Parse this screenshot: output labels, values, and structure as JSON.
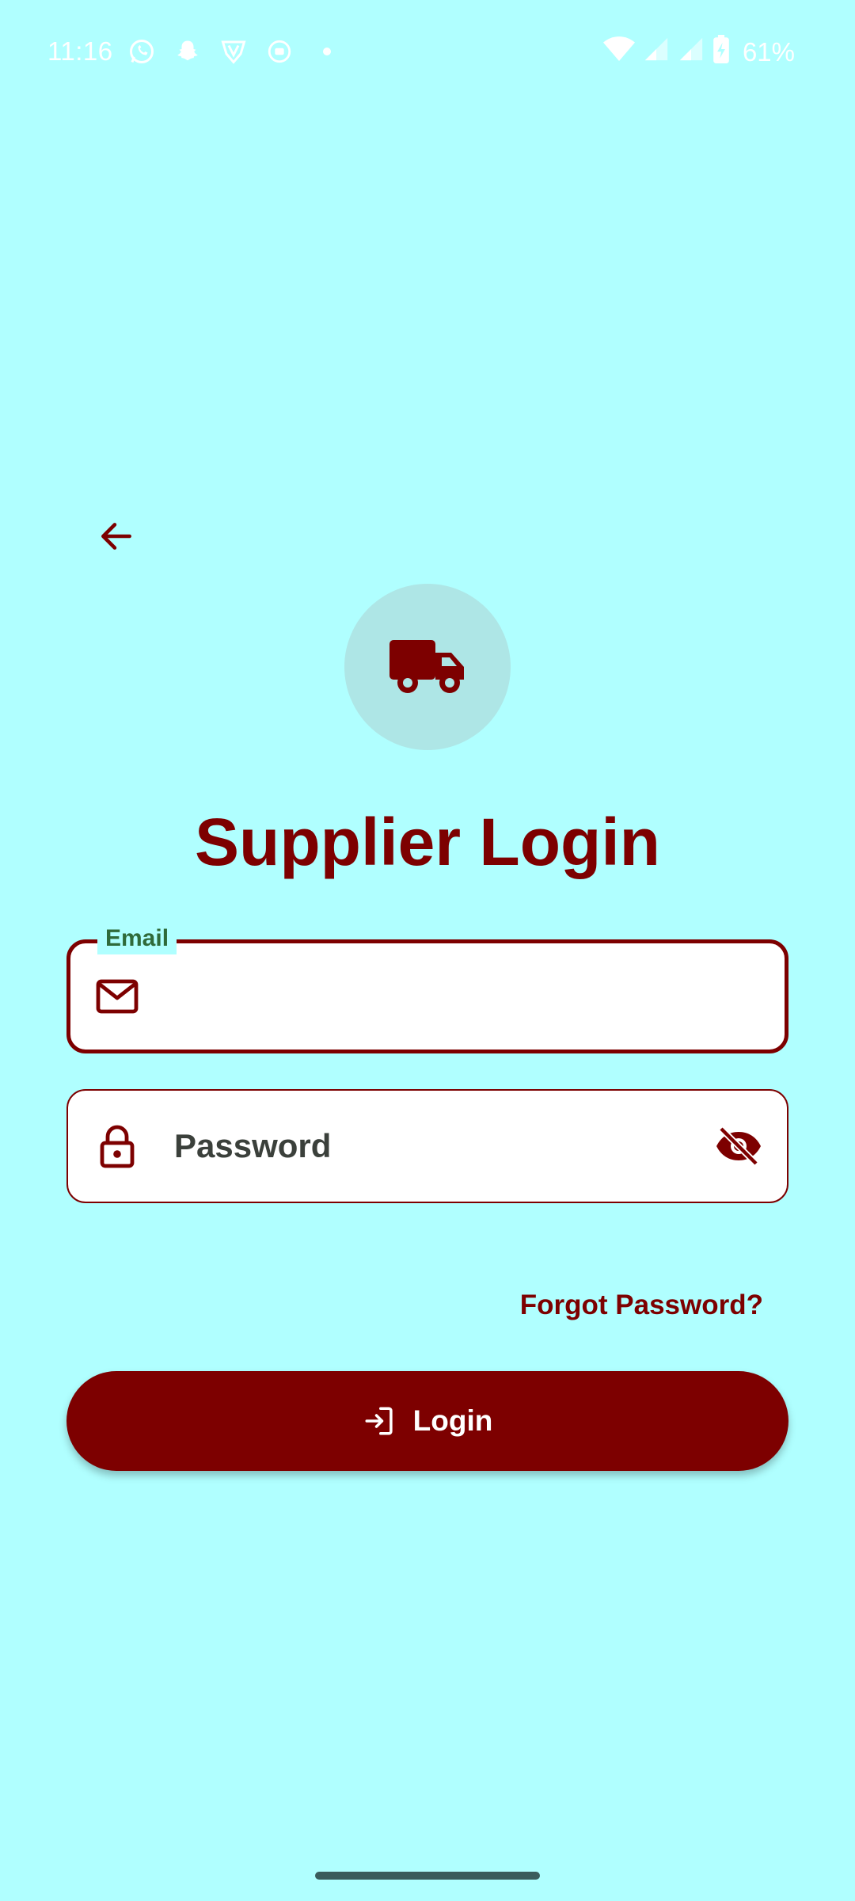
{
  "status_bar": {
    "time": "11:16",
    "battery": "61%",
    "icons_left": [
      "whatsapp-icon",
      "snapchat-icon",
      "vpn-icon",
      "cast-icon"
    ],
    "icons_right": [
      "wifi-icon",
      "signal-icon",
      "signal-icon",
      "battery-charging-icon"
    ]
  },
  "header": {
    "back_icon": "arrow-back-icon",
    "logo_icon": "truck-icon",
    "title": "Supplier Login"
  },
  "form": {
    "email": {
      "label": "Email",
      "value": "",
      "placeholder": "",
      "icon": "mail-icon"
    },
    "password": {
      "label": "",
      "value": "",
      "placeholder": "Password",
      "icon": "lock-icon",
      "toggle_icon": "visibility-off-icon"
    },
    "forgot_label": "Forgot Password?",
    "login_label": "Login",
    "login_icon": "login-icon"
  },
  "colors": {
    "background": "#b0ffff",
    "primary": "#7d0000",
    "label_green": "#2f6a3a",
    "logo_circle": "#aee6e6"
  }
}
